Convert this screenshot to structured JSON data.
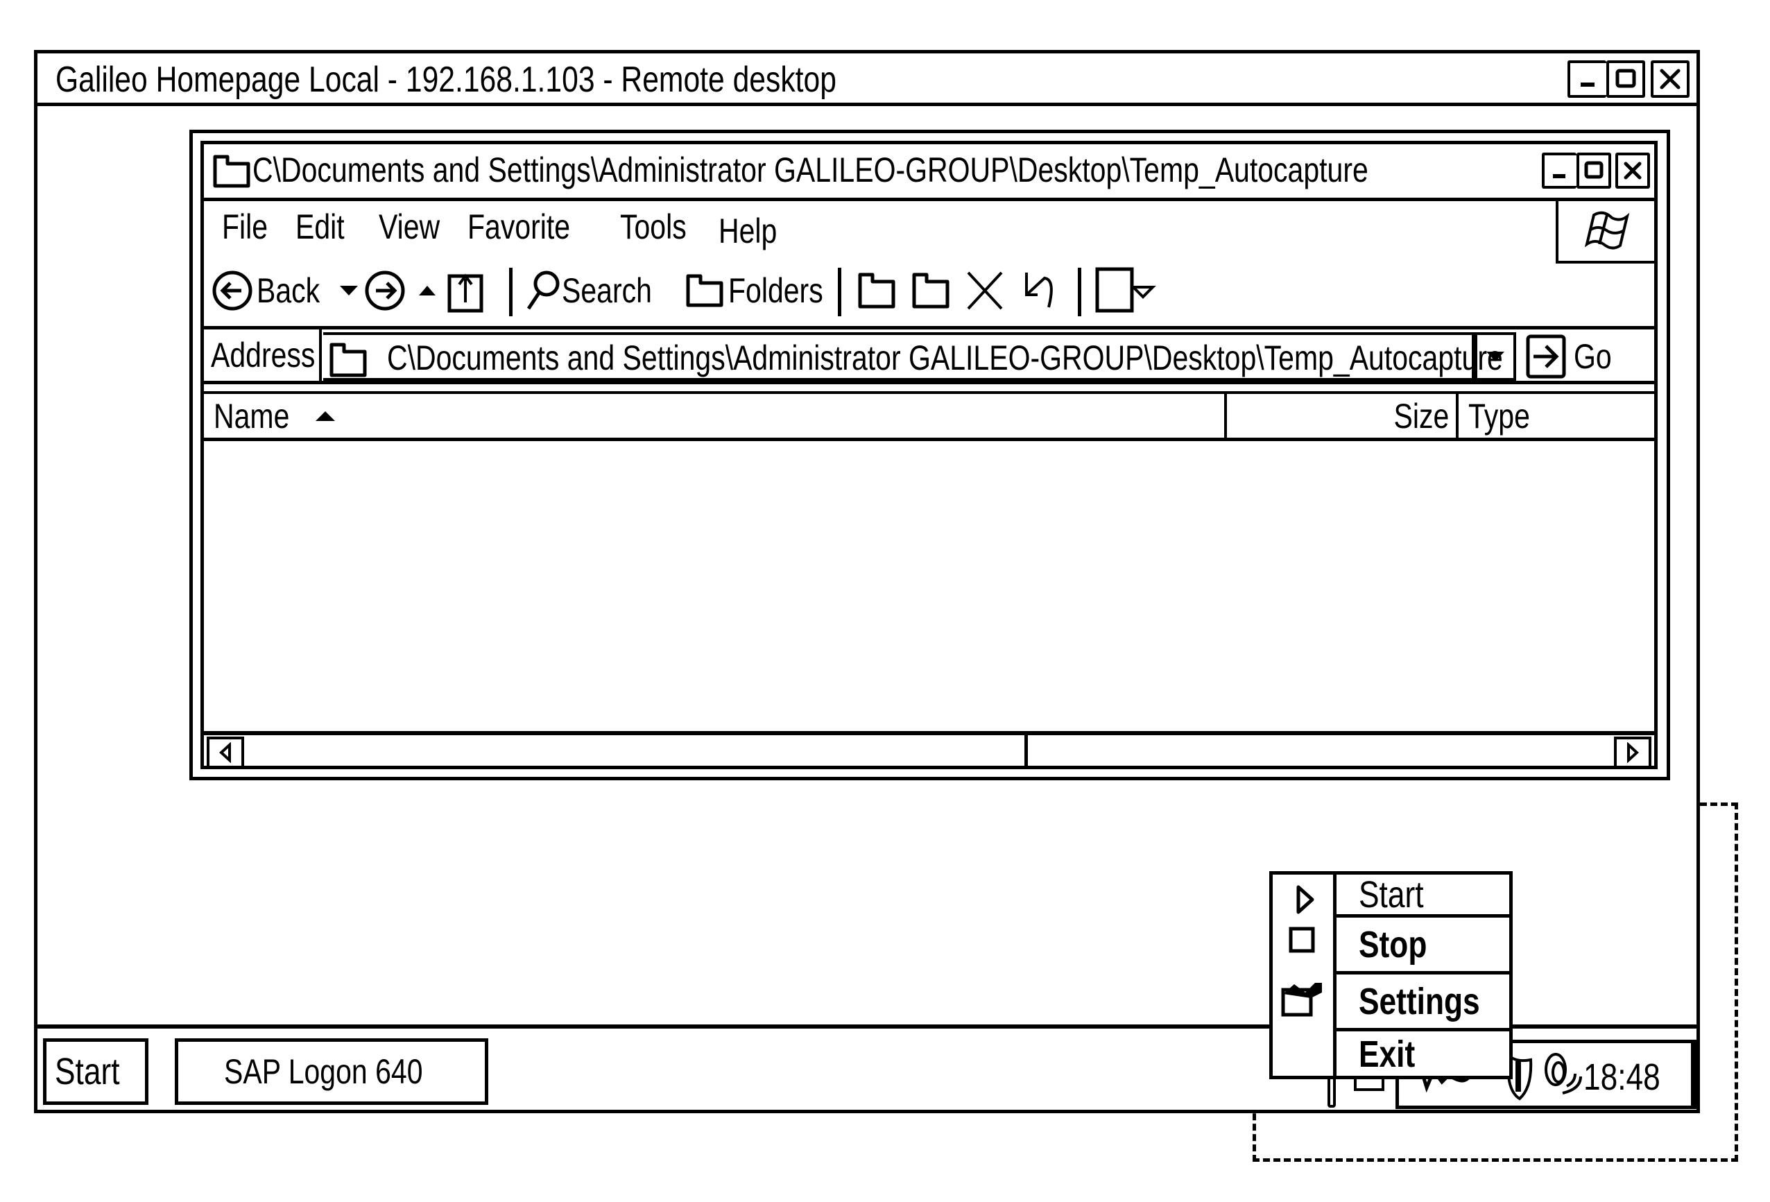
{
  "remote_window": {
    "title": "Galileo Homepage Local - 192.168.1.103 - Remote desktop",
    "controls": [
      "minimize-icon",
      "maximize-icon",
      "close-icon"
    ]
  },
  "explorer": {
    "title": "C\\Documents and Settings\\Administrator GALILEO-GROUP\\Desktop\\Temp_Autocapture",
    "menu": [
      "File",
      "Edit",
      "View",
      "Favorite",
      "Tools",
      "Help"
    ],
    "toolbar": {
      "back_label": "Back",
      "search_label": "Search",
      "folders_label": "Folders"
    },
    "address": {
      "label": "Address",
      "value": "C\\Documents and Settings\\Administrator GALILEO-GROUP\\Desktop\\Temp_Autocapture",
      "go_label": "Go"
    },
    "columns": [
      {
        "label": "Name",
        "sort": "ascending"
      },
      {
        "label": "Size"
      },
      {
        "label": "Type"
      }
    ],
    "rows": []
  },
  "taskbar": {
    "start_label": "Start",
    "task_label": "SAP Logon 640",
    "clock": "18:48"
  },
  "context_menu": {
    "items": [
      {
        "label": "Start",
        "icon": "play-icon",
        "bold": false
      },
      {
        "label": "Stop",
        "icon": "stop-icon",
        "bold": true
      },
      {
        "label": "Settings",
        "icon": "settings-icon",
        "bold": true
      },
      {
        "label": "Exit",
        "icon": "",
        "bold": true
      }
    ]
  }
}
